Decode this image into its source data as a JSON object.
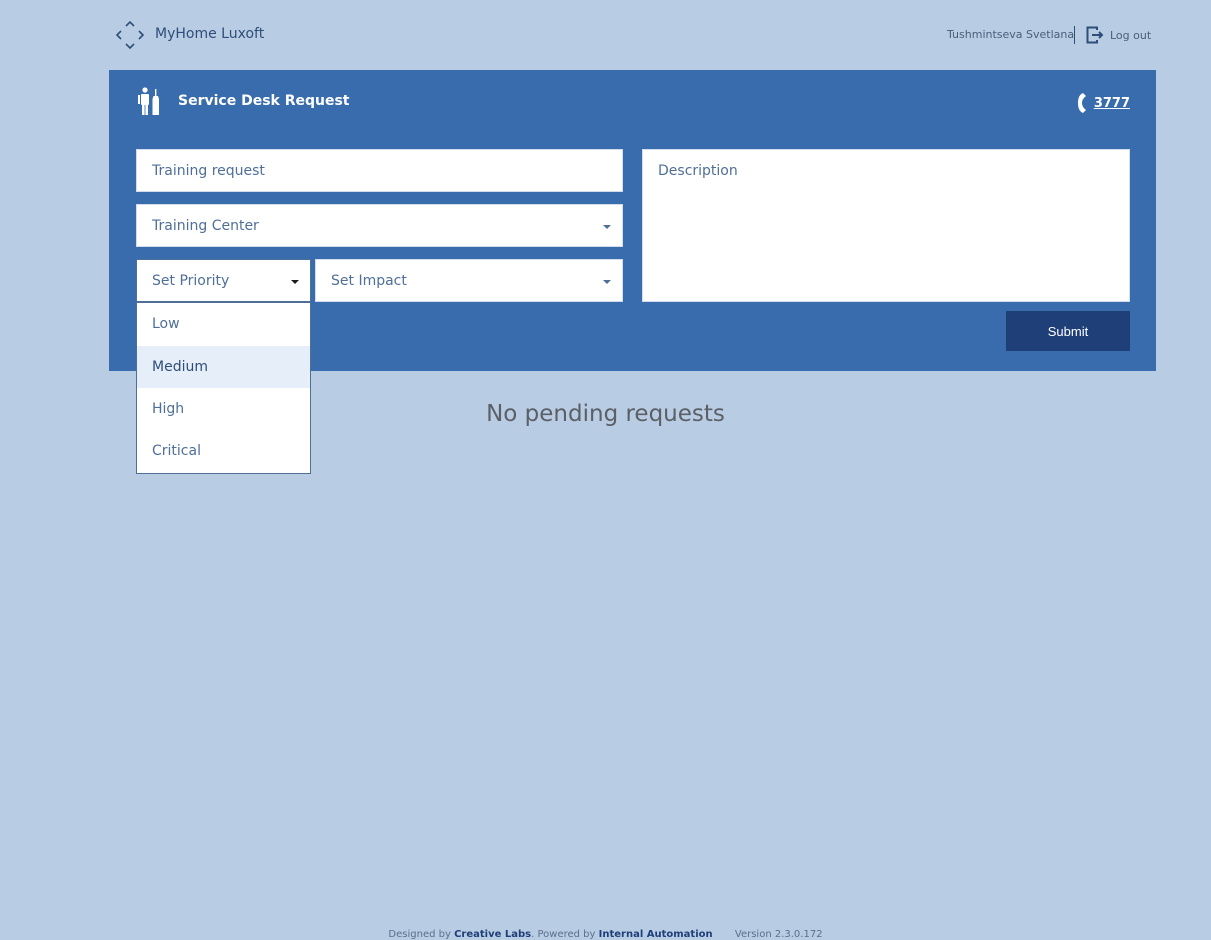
{
  "header": {
    "app_title": "MyHome Luxoft",
    "user_name": "Tushmintseva Svetlana",
    "logout_label": "Log out"
  },
  "panel": {
    "title": "Service Desk Request",
    "phone": "3777"
  },
  "form": {
    "subject_value": "Training request",
    "category_selected": "Training Center",
    "priority_placeholder": "Set Priority",
    "impact_placeholder": "Set Impact",
    "description_placeholder": "Description",
    "submit_label": "Submit",
    "priority_options": [
      "Low",
      "Medium",
      "High",
      "Critical"
    ],
    "priority_highlighted": "Medium"
  },
  "main": {
    "empty_message": "No pending requests"
  },
  "footer": {
    "designed_by_label": "Designed by",
    "designed_by_name": "Creative Labs",
    "powered_by_label": "Powered by",
    "powered_by_name": "Internal Automation",
    "version": "Version 2.3.0.172"
  },
  "colors": {
    "background": "#b8cde4",
    "panel": "#386cac",
    "submit": "#1f3f78",
    "highlight": "#e6eff9"
  }
}
